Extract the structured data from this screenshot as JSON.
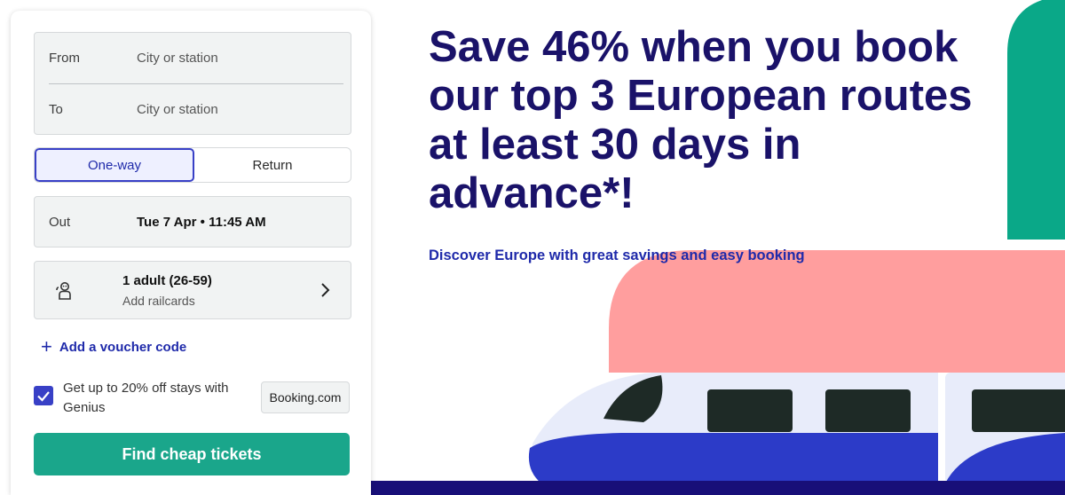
{
  "search_form": {
    "from_label": "From",
    "from_placeholder": "City or station",
    "to_label": "To",
    "to_placeholder": "City or station",
    "trip_types": [
      "One-way",
      "Return"
    ],
    "selected_trip_type": "One-way",
    "out_label": "Out",
    "out_value": "Tue 7 Apr • 11:45 AM",
    "passengers": "1 adult (26-59)",
    "railcards": "Add railcards",
    "voucher_label": "Add a voucher code",
    "genius_text": "Get up to 20% off stays with Genius",
    "genius_checked": true,
    "booking_label": "Booking.com",
    "submit_label": "Find cheap tickets"
  },
  "hero": {
    "headline": "Save 46% when you book our top 3 European routes at least 30 days in advance*!",
    "subline": "Discover Europe with great savings and easy booking"
  },
  "colors": {
    "brand_green": "#1aa68b",
    "headline_navy": "#1a1269",
    "accent_blue": "#3840c6",
    "train_pink": "#ff9e9e",
    "train_teal": "#0aa888"
  },
  "icons": {
    "passenger": "passenger-icon",
    "chevron": "chevron-right-icon",
    "plus": "plus-icon",
    "checkbox": "checkmark-icon"
  }
}
